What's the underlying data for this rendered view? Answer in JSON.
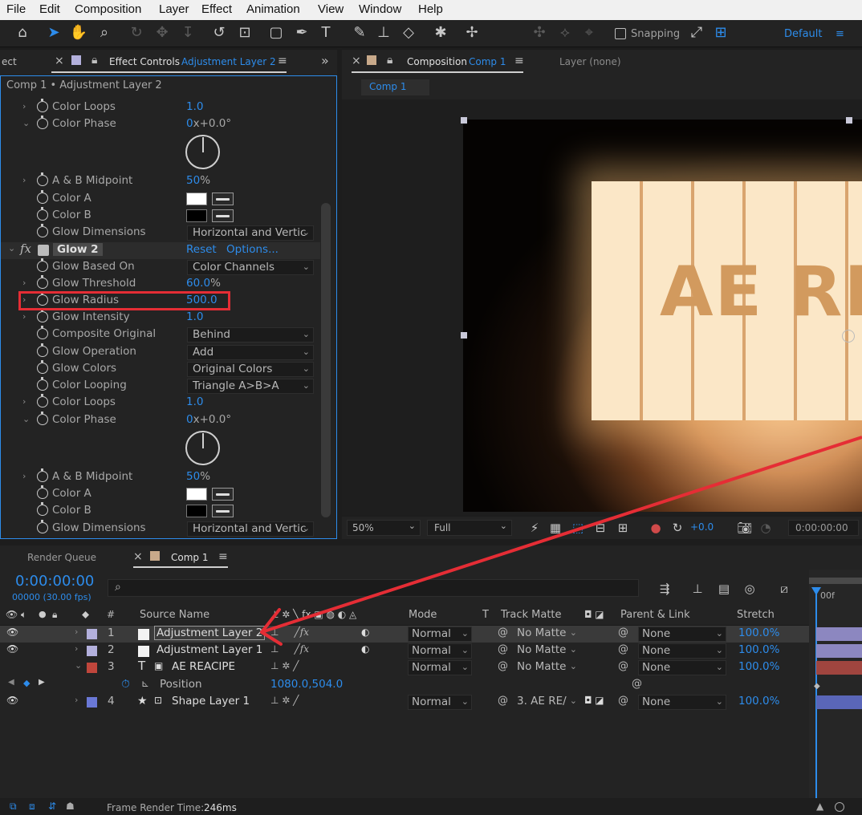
{
  "menu": [
    "File",
    "Edit",
    "Composition",
    "Layer",
    "Effect",
    "Animation",
    "View",
    "Window",
    "Help"
  ],
  "toolbar": {
    "snapping_label": "Snapping",
    "workspace": "Default",
    "workspace_menu": "≡"
  },
  "effect_controls": {
    "tab_prev_partial": "ect",
    "tab_close": "×",
    "tab_label": "Effect Controls",
    "tab_layer": "Adjustment Layer 2",
    "tab_menu": "≡",
    "tab_overflow": "»",
    "header": "Comp 1 • Adjustment Layer 2",
    "glow1_props": [
      {
        "name": "Color Loops",
        "value": "1.0"
      },
      {
        "name": "Color Phase",
        "value": "0",
        "value_suffix": "x+0.0",
        "unit": "°"
      },
      {
        "name": "A & B Midpoint",
        "value": "50",
        "unit": "%"
      },
      {
        "name": "Color A"
      },
      {
        "name": "Color B"
      },
      {
        "name": "Glow Dimensions",
        "dropdown": "Horizontal and Vertic"
      }
    ],
    "glow2": {
      "fx_label": "fx",
      "name": "Glow 2",
      "reset": "Reset",
      "options": "Options..."
    },
    "glow2_props": [
      {
        "name": "Glow Based On",
        "dropdown": "Color Channels"
      },
      {
        "name": "Glow Threshold",
        "value": "60.0",
        "unit": "%"
      },
      {
        "name": "Glow Radius",
        "value": "500.0"
      },
      {
        "name": "Glow Intensity",
        "value": "1.0"
      },
      {
        "name": "Composite Original",
        "dropdown": "Behind"
      },
      {
        "name": "Glow Operation",
        "dropdown": "Add"
      },
      {
        "name": "Glow Colors",
        "dropdown": "Original Colors"
      },
      {
        "name": "Color Looping",
        "dropdown": "Triangle A>B>A"
      },
      {
        "name": "Color Loops",
        "value": "1.0"
      },
      {
        "name": "Color Phase",
        "value": "0",
        "value_suffix": "x+0.0",
        "unit": "°"
      },
      {
        "name": "A & B Midpoint",
        "value": "50",
        "unit": "%"
      },
      {
        "name": "Color A"
      },
      {
        "name": "Color B"
      },
      {
        "name": "Glow Dimensions",
        "dropdown": "Horizontal and Vertic"
      }
    ]
  },
  "composition": {
    "tab_close": "×",
    "tab_label": "Composition",
    "tab_comp": "Comp 1",
    "tab_menu": "≡",
    "layer_tab": "Layer (none)",
    "sub_tab": "Comp 1",
    "preview_text": "AE RE",
    "zoom": "50%",
    "resolution": "Full",
    "exposure": "+0.0",
    "timecode": "0:00:00:00"
  },
  "timeline": {
    "render_queue_tab": "Render Queue",
    "comp_tab_close": "×",
    "comp_tab": "Comp 1",
    "comp_tab_menu": "≡",
    "current_time": "0:00:00:00",
    "frame_info": "00000 (30.00 fps)",
    "search_placeholder": "",
    "ruler_label": "00f",
    "columns": {
      "num": "#",
      "source_name": "Source Name",
      "mode": "Mode",
      "t": "T",
      "track_matte": "Track Matte",
      "parent_link": "Parent & Link",
      "stretch": "Stretch"
    },
    "layers": [
      {
        "num": "1",
        "name": "Adjustment Layer 2",
        "mode": "Normal",
        "matte": "No Matte",
        "parent": "None",
        "stretch": "100.0%",
        "label_color": "#b3b0dc",
        "bar_color": "#8c87c0"
      },
      {
        "num": "2",
        "name": "Adjustment Layer 1",
        "mode": "Normal",
        "matte": "No Matte",
        "parent": "None",
        "stretch": "100.0%",
        "label_color": "#b3b0dc",
        "bar_color": "#8c87c0"
      },
      {
        "num": "3",
        "type_glyph": "T",
        "name": "AE REACIPE",
        "mode": "Normal",
        "matte": "No Matte",
        "parent": "None",
        "stretch": "100.0%",
        "label_color": "#c0463c",
        "bar_color": "#a0453f"
      },
      {
        "num": "4",
        "type_glyph": "★",
        "name": "Shape Layer 1",
        "mode": "Normal",
        "matte": "3. AE RE/",
        "parent": "None",
        "stretch": "100.0%",
        "label_color": "#6a78d6",
        "bar_color": "#5a66b8"
      }
    ],
    "position_prop": {
      "name": "Position",
      "value": "1080.0,504.0"
    }
  },
  "status": {
    "frame_render_label": "Frame Render Time:",
    "frame_render_value": "246ms"
  },
  "colors": {
    "accent": "#2d8ceb",
    "highlight_red": "#e52d35"
  }
}
